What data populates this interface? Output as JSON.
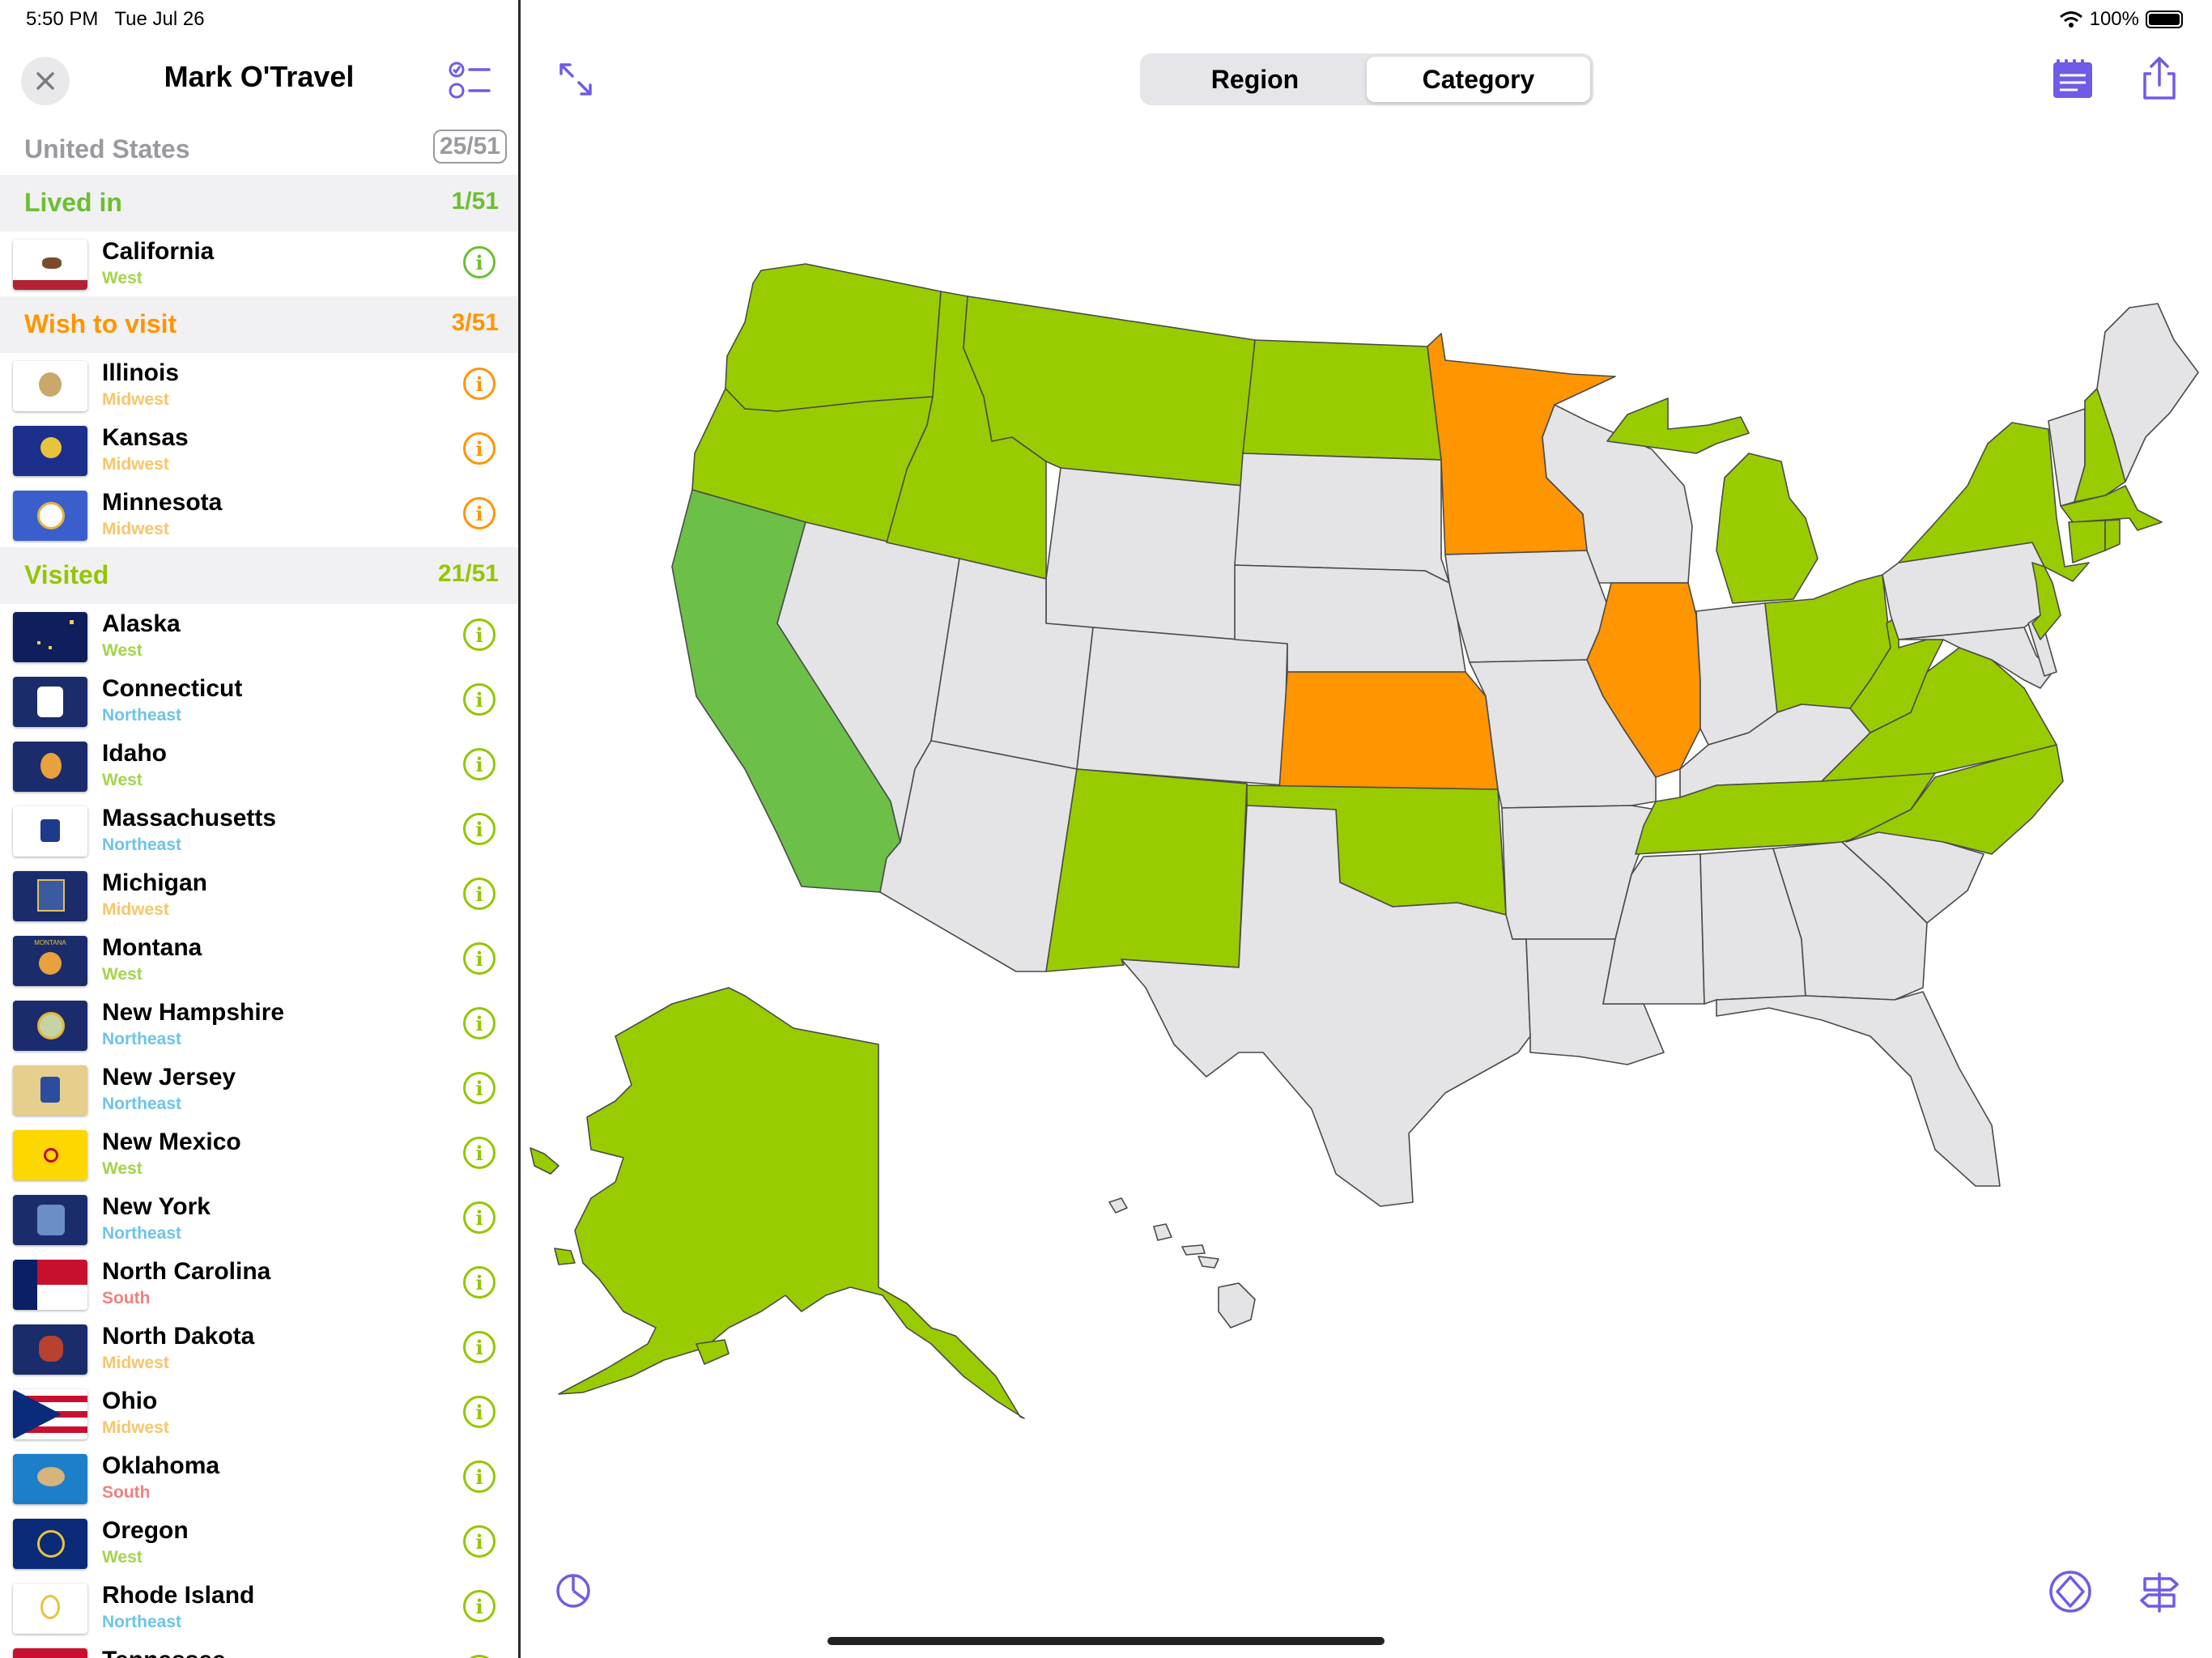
{
  "status_bar": {
    "time": "5:50 PM",
    "date": "Tue Jul 26",
    "battery": "100%"
  },
  "sidebar": {
    "title": "Mark O'Travel",
    "country": "United States",
    "country_count": "25/51",
    "sections": [
      {
        "label": "Lived in",
        "count": "1/51",
        "color": "#6cbf2f",
        "items": [
          {
            "name": "California",
            "region": "West"
          }
        ]
      },
      {
        "label": "Wish to visit",
        "count": "3/51",
        "color": "#ff9500",
        "items": [
          {
            "name": "Illinois",
            "region": "Midwest"
          },
          {
            "name": "Kansas",
            "region": "Midwest"
          },
          {
            "name": "Minnesota",
            "region": "Midwest"
          }
        ]
      },
      {
        "label": "Visited",
        "count": "21/51",
        "color": "#94c600",
        "items": [
          {
            "name": "Alaska",
            "region": "West"
          },
          {
            "name": "Connecticut",
            "region": "Northeast"
          },
          {
            "name": "Idaho",
            "region": "West"
          },
          {
            "name": "Massachusetts",
            "region": "Northeast"
          },
          {
            "name": "Michigan",
            "region": "Midwest"
          },
          {
            "name": "Montana",
            "region": "West"
          },
          {
            "name": "New Hampshire",
            "region": "Northeast"
          },
          {
            "name": "New Jersey",
            "region": "Northeast"
          },
          {
            "name": "New Mexico",
            "region": "West"
          },
          {
            "name": "New York",
            "region": "Northeast"
          },
          {
            "name": "North Carolina",
            "region": "South"
          },
          {
            "name": "North Dakota",
            "region": "Midwest"
          },
          {
            "name": "Ohio",
            "region": "Midwest"
          },
          {
            "name": "Oklahoma",
            "region": "South"
          },
          {
            "name": "Oregon",
            "region": "West"
          },
          {
            "name": "Rhode Island",
            "region": "Northeast"
          },
          {
            "name": "Tennessee",
            "region": ""
          }
        ]
      }
    ]
  },
  "region_colors": {
    "West": "#a4d34b",
    "Midwest": "#f7c66a",
    "Northeast": "#6cc4e8",
    "South": "#f08080"
  },
  "segmented_control": {
    "options": [
      "Region",
      "Category"
    ],
    "selected": "Category"
  },
  "map_colors": {
    "lived": "#6cbf47",
    "wish": "#ff9500",
    "visited": "#99cc00",
    "none": "#e4e4e6"
  },
  "accent_color": "#6e5ce6"
}
